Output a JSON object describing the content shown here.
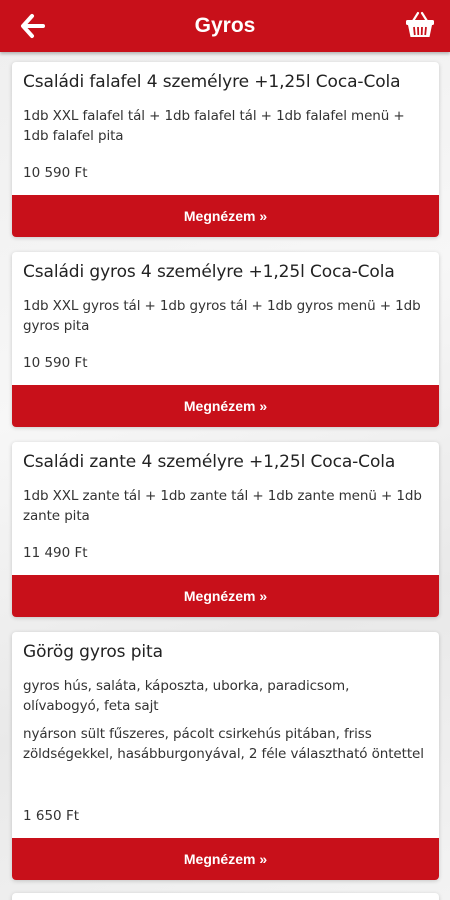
{
  "header": {
    "title": "Gyros",
    "back_icon": "arrow-left-icon",
    "cart_icon": "shopping-basket-icon"
  },
  "colors": {
    "accent": "#c8101a"
  },
  "products": [
    {
      "title": "Családi falafel 4 személyre +1,25l Coca-Cola",
      "description": "1db XXL falafel tál + 1db falafel tál +  1db falafel menü + 1db falafel pita",
      "price": "10 590 Ft",
      "button": "Megnézem »"
    },
    {
      "title": "Családi gyros 4 személyre +1,25l Coca-Cola",
      "description": "1db XXL gyros tál + 1db gyros tál +  1db gyros menü + 1db gyros pita",
      "price": "10 590 Ft",
      "button": "Megnézem »"
    },
    {
      "title": "Családi zante 4 személyre +1,25l Coca-Cola",
      "description": "1db XXL zante tál + 1db zante tál +  1db zante menü + 1db zante pita",
      "price": "11 490 Ft",
      "button": "Megnézem »"
    },
    {
      "title": "Görög gyros pita",
      "description": "gyros hús, saláta, káposzta, uborka, paradicsom, olívabogyó, feta sajt",
      "description2": "nyárson sült fűszeres, pácolt csirkehús pitában, friss zöldségekkel, hasábburgonyával, 2 féle választható öntettel",
      "price": "1 650 Ft",
      "button": "Megnézem »"
    }
  ]
}
